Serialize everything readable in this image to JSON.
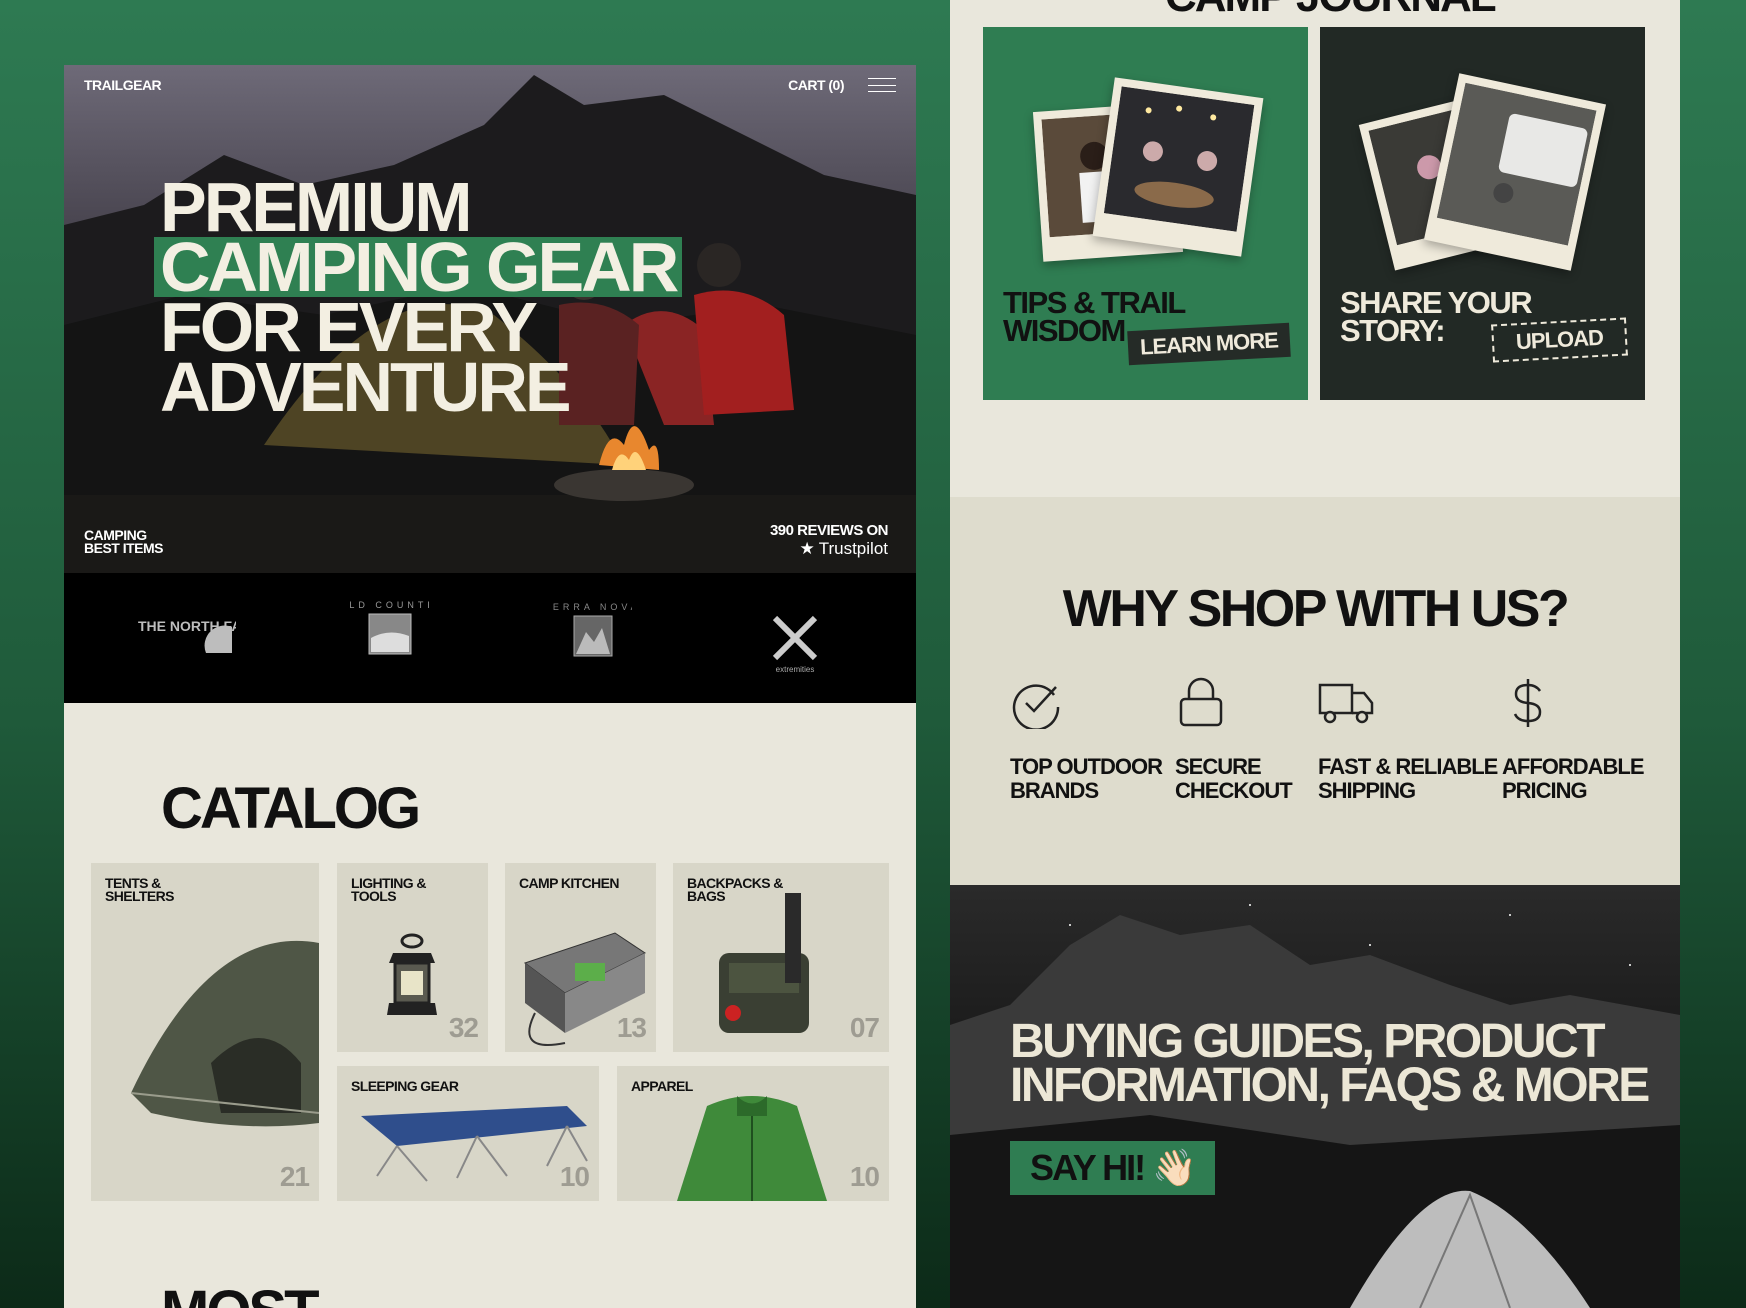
{
  "header": {
    "logo": "TRAILGEAR",
    "cart": "CART (0)"
  },
  "hero": {
    "line1": "PREMIUM",
    "line2": "CAMPING GEAR",
    "line3": "FOR EVERY",
    "line4": "ADVENTURE",
    "tag_line1": "CAMPING",
    "tag_line2": "BEST ITEMS",
    "reviews": "390 REVIEWS ON",
    "trustpilot": "Trustpilot"
  },
  "brands": [
    {
      "name": "THE NORTH FACE",
      "icon": "north-face-logo"
    },
    {
      "name": "WILD COUNTRY",
      "icon": "wild-country-logo"
    },
    {
      "name": "TERRA NOVA",
      "icon": "terra-nova-logo"
    },
    {
      "name": "extremities",
      "icon": "extremities-logo"
    }
  ],
  "catalog": {
    "title": "CATALOG",
    "items": [
      {
        "label": "TENTS & SHELTERS",
        "count": "21"
      },
      {
        "label": "LIGHTING & TOOLS",
        "count": "32"
      },
      {
        "label": "CAMP KITCHEN",
        "count": "13"
      },
      {
        "label": "BACKPACKS & BAGS",
        "count": "07"
      },
      {
        "label": "SLEEPING GEAR",
        "count": "10"
      },
      {
        "label": "APPAREL",
        "count": "10"
      }
    ]
  },
  "most_heading": "MOST",
  "journal": {
    "title": "CAMP JOURNAL",
    "card1": {
      "line1": "TIPS & TRAIL",
      "line2": "WISDOM",
      "button": "LEARN MORE"
    },
    "card2": {
      "line1": "SHARE YOUR",
      "line2": "STORY:",
      "button": "UPLOAD"
    }
  },
  "why": {
    "title": "WHY SHOP WITH US?",
    "features": [
      {
        "line1": "TOP OUTDOOR",
        "line2": "BRANDS",
        "icon": "check-circle-icon"
      },
      {
        "line1": "SECURE",
        "line2": "CHECKOUT",
        "icon": "lock-icon"
      },
      {
        "line1": "FAST & RELIABLE",
        "line2": "SHIPPING",
        "icon": "truck-icon"
      },
      {
        "line1": "AFFORDABLE",
        "line2": "PRICING",
        "icon": "dollar-icon"
      }
    ]
  },
  "guides": {
    "line1": "BUYING GUIDES, PRODUCT",
    "line2": "INFORMATION, FAQS & MORE",
    "button": "SAY HI! 👋🏻"
  },
  "colors": {
    "brand_green": "#2f7d52",
    "cream": "#e9e7dc",
    "dark": "#222925"
  }
}
